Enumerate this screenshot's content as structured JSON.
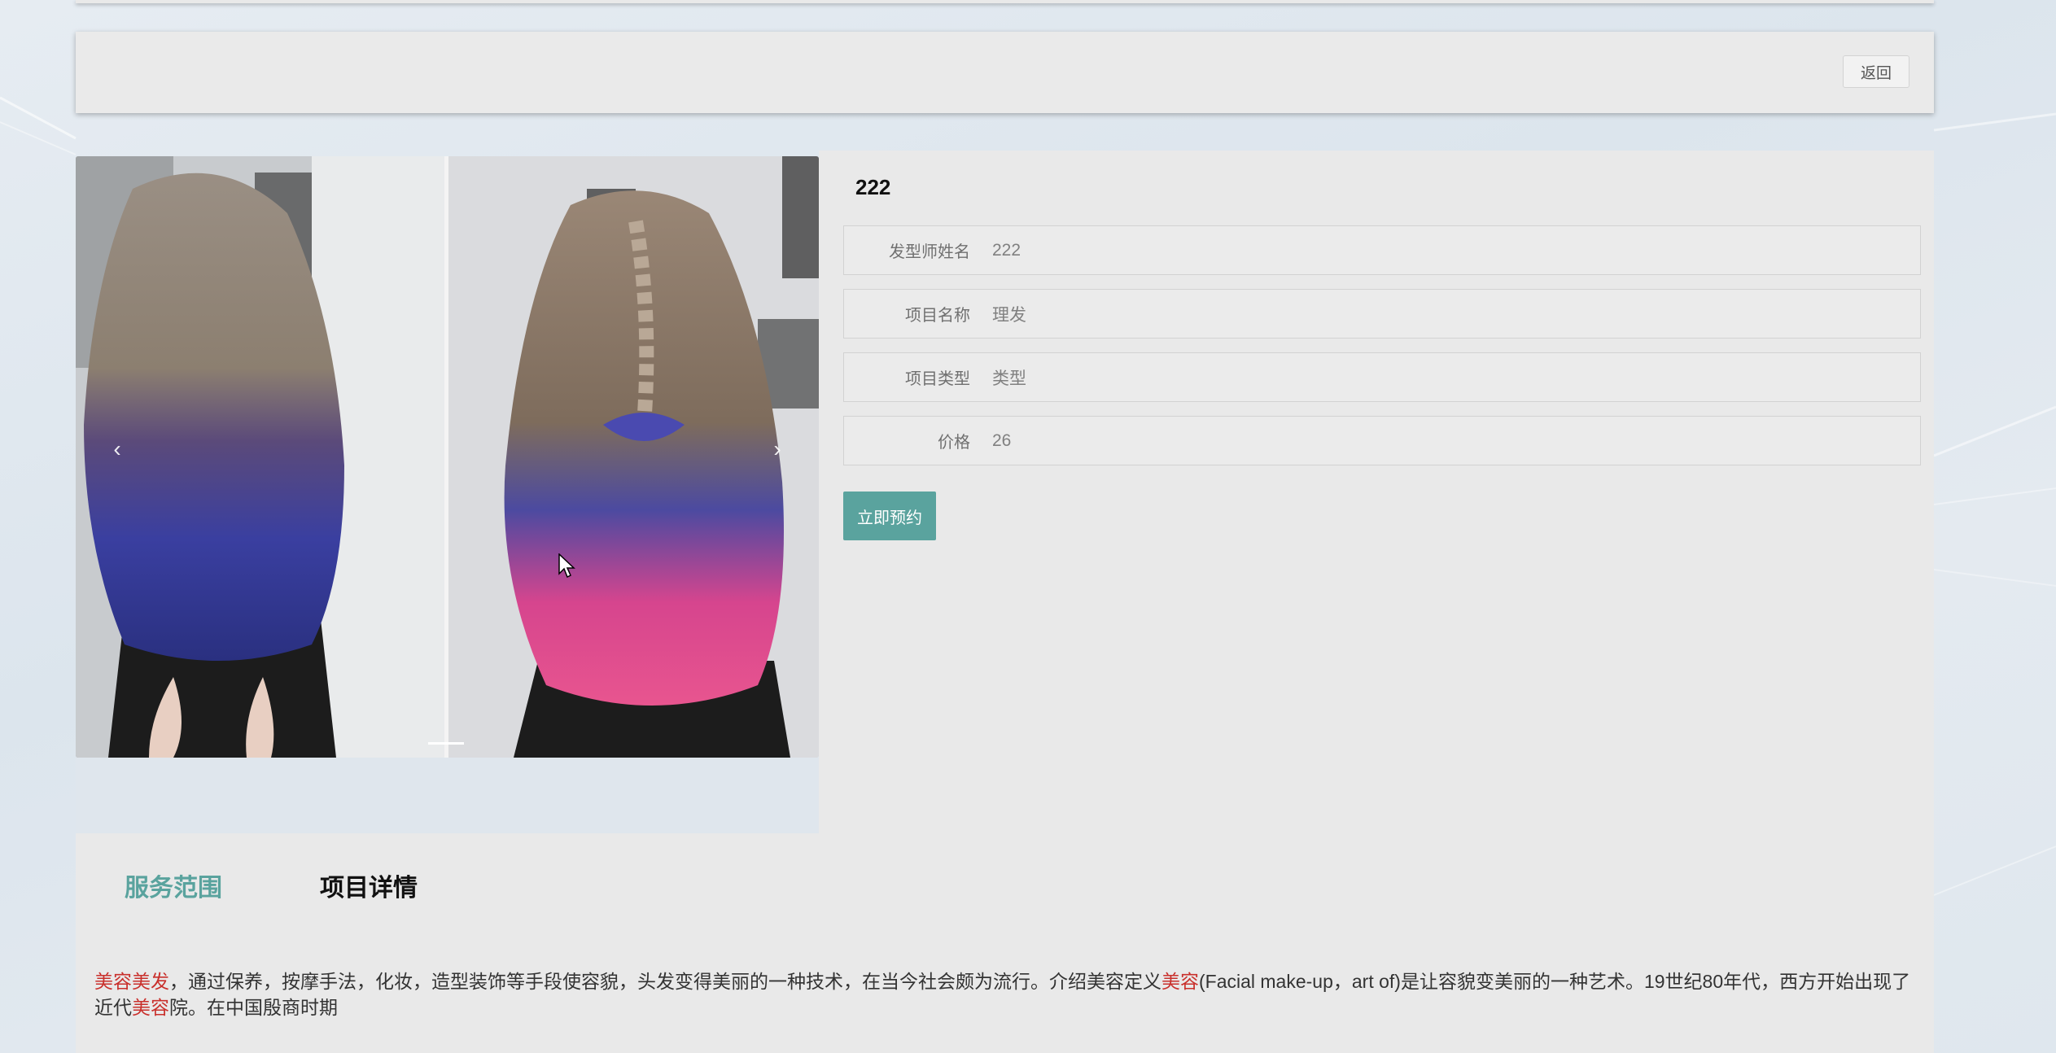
{
  "header": {
    "back_label": "返回"
  },
  "carousel": {
    "prev_icon": "chevron-left-icon",
    "next_icon": "chevron-right-icon",
    "prev_glyph": "‹",
    "next_glyph": "›",
    "active_slide": 1
  },
  "item": {
    "title": "222",
    "fields": [
      {
        "label": "发型师姓名",
        "value": "222"
      },
      {
        "label": "项目名称",
        "value": "理发"
      },
      {
        "label": "项目类型",
        "value": "类型"
      },
      {
        "label": "价格",
        "value": "26"
      }
    ],
    "book_label": "立即预约"
  },
  "tabs": [
    {
      "label": "服务范围",
      "active": true
    },
    {
      "label": "项目详情",
      "active": false
    }
  ],
  "description": {
    "seg1_hl": "美容美发",
    "seg2": "，通过保养，按摩手法，化妆，造型装饰等手段使容貌，头发变得美丽的一种技术，在当今社会颇为流行。介绍美容定义",
    "seg3_hl": "美容",
    "seg4": "(Facial make-up，art of)是让容貌变美丽的一种艺术。19世纪80年代，西方开始出现了近代",
    "seg5_hl": "美容",
    "seg6": "院。在中国殷商时期"
  },
  "colors": {
    "accent": "#5aa39e",
    "highlight": "#c9302c",
    "panel": "#e9e9e9"
  }
}
